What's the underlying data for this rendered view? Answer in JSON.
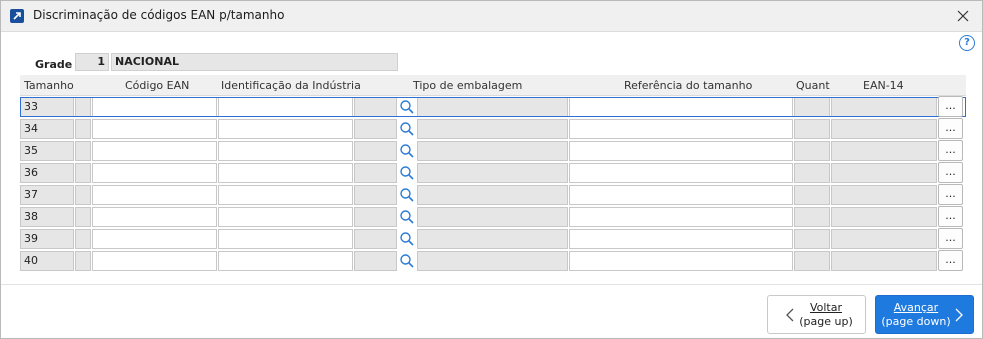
{
  "window": {
    "title": "Discriminação de códigos EAN p/tamanho"
  },
  "grade": {
    "label": "Grade",
    "code": "1",
    "name": "NACIONAL"
  },
  "table": {
    "headers": {
      "size": "Tamanho",
      "ean": "Código EAN",
      "industry_id": "Identificação da Indústria",
      "packaging": "Tipo de embalagem",
      "size_ref": "Referência do tamanho",
      "quant": "Quant",
      "ean14": "EAN-14"
    },
    "rows": [
      {
        "size": "33"
      },
      {
        "size": "34"
      },
      {
        "size": "35"
      },
      {
        "size": "36"
      },
      {
        "size": "37"
      },
      {
        "size": "38"
      },
      {
        "size": "39"
      },
      {
        "size": "40"
      }
    ],
    "more_label": "..."
  },
  "footer": {
    "back_label": "Voltar",
    "back_hint": "(page up)",
    "next_label": "Avançar",
    "next_hint": "(page down)"
  },
  "icons": {
    "app": "arrow-up-right-icon",
    "close": "close-icon",
    "help": "help-icon",
    "search": "search-icon",
    "back": "chevron-left-icon",
    "next": "chevron-right-icon"
  },
  "colors": {
    "accent": "#1f7ae0",
    "search_icon": "#2b7bd6",
    "readonly_bg": "#e6e6e6"
  }
}
